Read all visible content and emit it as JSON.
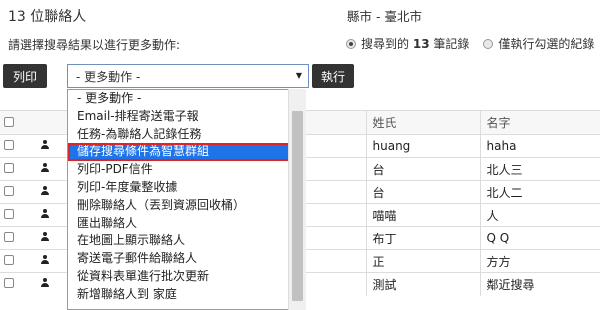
{
  "header": {
    "title": "13 位聯絡人",
    "city": "縣市 - 臺北市"
  },
  "instruction": "請選擇搜尋結果以進行更多動作:",
  "selection_radio": {
    "option_all_prefix": "搜尋到的",
    "option_all_count": "13",
    "option_all_suffix": "筆記錄",
    "option_checked": "僅執行勾選的紀錄",
    "selected": "all"
  },
  "toolbar": {
    "print_label": "列印",
    "execute_label": "執行",
    "actions_select_value": "- 更多動作 -"
  },
  "actions_dropdown": {
    "items": [
      "- 更多動作 -",
      "Email-排程寄送電子報",
      "任務-為聯絡人記錄任務",
      "儲存搜尋條件為智慧群組",
      "列印-PDF信件",
      "列印-年度彙整收據",
      "刪除聯絡人（丟到資源回收桶）",
      "匯出聯絡人",
      "在地圖上顯示聯絡人",
      "寄送電子郵件給聯絡人",
      "從資料表單進行批次更新",
      "新增聯絡人到 家庭"
    ],
    "highlighted_index": 3
  },
  "table": {
    "columns": [
      "",
      "",
      "",
      "姓氏",
      "名字"
    ],
    "rows": [
      {
        "last": "huang",
        "first": "haha"
      },
      {
        "last": "台",
        "first": "北人三"
      },
      {
        "last": "台",
        "first": "北人二"
      },
      {
        "last": "喵喵",
        "first": "人"
      },
      {
        "last": "布丁",
        "first": "Q Q"
      },
      {
        "last": "正",
        "first": "方方"
      },
      {
        "last": "測試",
        "first": "鄰近搜尋"
      }
    ]
  },
  "icons": {
    "select_arrow": "chevron-down-icon",
    "row_type": "person-icon"
  },
  "colors": {
    "highlight": "#1e73e8",
    "highlight_border": "#e02424",
    "dark_button": "#333333"
  }
}
